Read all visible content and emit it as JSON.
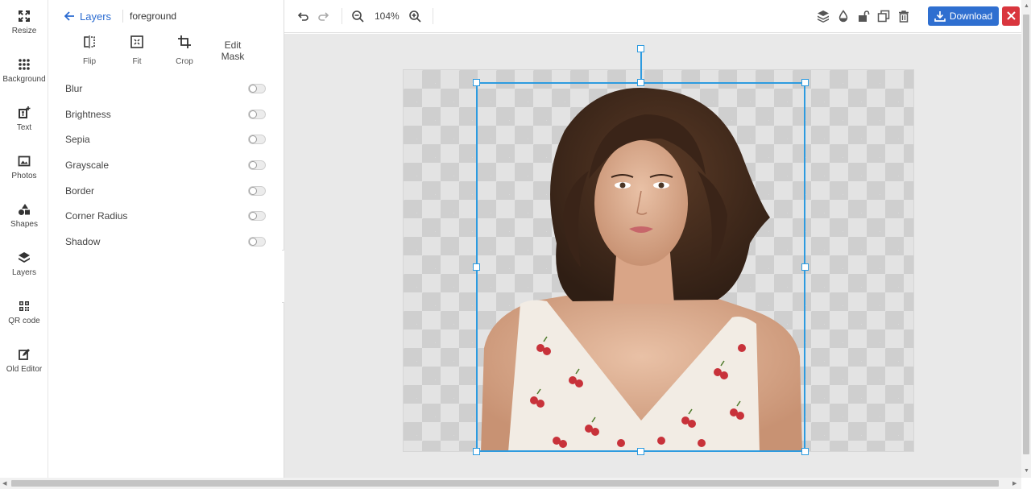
{
  "rail": {
    "items": [
      {
        "label": "Resize",
        "icon": "resize-icon"
      },
      {
        "label": "Background",
        "icon": "grid-dots-icon"
      },
      {
        "label": "Text",
        "icon": "add-text-icon"
      },
      {
        "label": "Photos",
        "icon": "image-icon"
      },
      {
        "label": "Shapes",
        "icon": "shapes-icon"
      },
      {
        "label": "Layers",
        "icon": "layers-icon"
      },
      {
        "label": "QR code",
        "icon": "qr-code-icon"
      },
      {
        "label": "Old Editor",
        "icon": "edit-icon"
      }
    ]
  },
  "panel": {
    "back_label": "Layers",
    "layer_name": "foreground",
    "tools": [
      {
        "label": "Flip",
        "icon": "flip-icon"
      },
      {
        "label": "Fit",
        "icon": "fit-icon"
      },
      {
        "label": "Crop",
        "icon": "crop-icon"
      }
    ],
    "edit_mask_label": "Edit Mask",
    "effects": [
      {
        "label": "Blur",
        "enabled": false
      },
      {
        "label": "Brightness",
        "enabled": false
      },
      {
        "label": "Sepia",
        "enabled": false
      },
      {
        "label": "Grayscale",
        "enabled": false
      },
      {
        "label": "Border",
        "enabled": false
      },
      {
        "label": "Corner Radius",
        "enabled": false
      },
      {
        "label": "Shadow",
        "enabled": false
      }
    ]
  },
  "toolbar": {
    "zoom": "104%",
    "download_label": "Download",
    "icons": [
      "undo-icon",
      "redo-icon",
      "zoom-out-icon",
      "zoom-in-icon",
      "layers-stack-icon",
      "opacity-drop-icon",
      "unlock-icon",
      "duplicate-icon",
      "trash-icon",
      "download-icon",
      "close-icon"
    ]
  },
  "colors": {
    "accent": "#2f6fd0",
    "link": "#2a6bd1",
    "selection": "#2d9be0",
    "close": "#d9363e"
  }
}
